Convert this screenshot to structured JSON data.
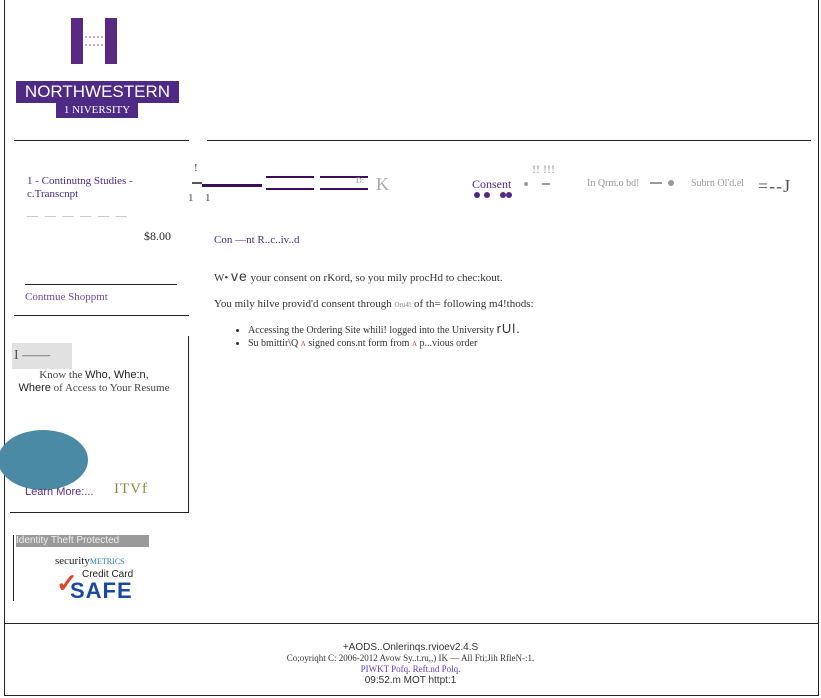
{
  "brand": {
    "name": "NORTHWESTERN",
    "sub": "1 NIVERSITY",
    "color": "#4e2a84"
  },
  "sidebar": {
    "item_title": "1 - Continutng Studies - c.Transcnpt",
    "item_dashes": "— — — — — —",
    "price": "$8.00",
    "continue_label": "Contmue Shoppmt",
    "promo": {
      "grey_label": "I ——",
      "text_1": "Know the",
      "text_2": "Who, Whe:n,",
      "text_3": "Where",
      "text_4": "of Access to Your Resume",
      "learn_more": "Learn More:...",
      "mark": "ITVf"
    },
    "badge": {
      "header": "Identity Theft Protected",
      "brand": "security",
      "brand_sup": "METRICS",
      "line": "Credit Card",
      "safe": "SAFE"
    }
  },
  "steps": {
    "consent_label": "Consent",
    "info_label": "In Qrm.o bd!",
    "submit_label": "Subrn Ol'd.el",
    "end_mark": "=--J",
    "tick_1": "1",
    "tick_2": "1",
    "dk": "D:",
    "k": "K",
    "ii": "!! !!!",
    "bang": "!"
  },
  "main": {
    "title": "Con —nt R..c..iv..d",
    "p1_a": "W•",
    "p1_big": "ve",
    "p1_b": "your consent on rKord, so you mily procHd to chec:kout.",
    "p2_a": "You mily hilve provid'd consent through",
    "p2_tiny": "Oru4!",
    "p2_b": "of th= following m4!thods:",
    "li1_a": "Accessing the Ordering Site whili! logged into the University",
    "li1_big": "rUl.",
    "li2_a": "Su bmittir\\Q",
    "li2_tiny": "A",
    "li2_b": "signed cons.nt form from",
    "li2_tiny2": "A",
    "li2_c": "p...vious order"
  },
  "footer": {
    "line1": "+AODS..Onlerinqs.rvioev2.4.S",
    "line2": "Co;oyriqht C: 2006-2012 Avow Sy..t.ru,,) IK — All Fti;Jih RfleN-:1.",
    "line3": "PIWKT Pofq. Reft.nd Polq.",
    "line4": "09:52.m MOT httpt:1"
  }
}
